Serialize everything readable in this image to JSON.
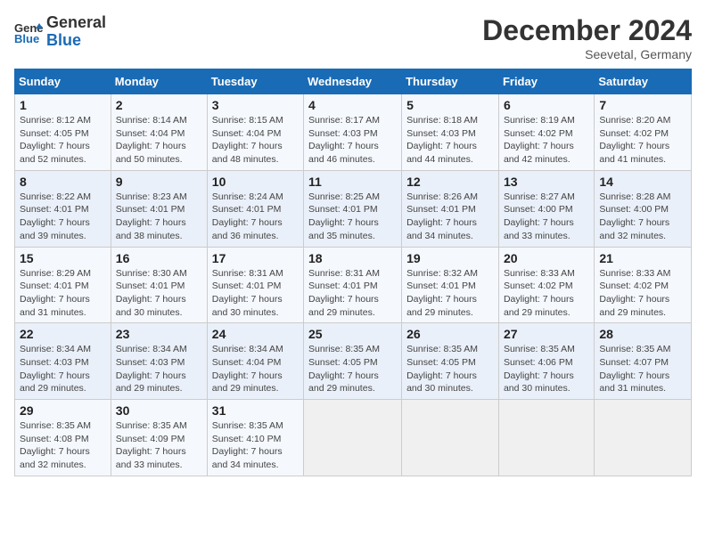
{
  "logo": {
    "line1": "General",
    "line2": "Blue"
  },
  "title": "December 2024",
  "subtitle": "Seevetal, Germany",
  "days_of_week": [
    "Sunday",
    "Monday",
    "Tuesday",
    "Wednesday",
    "Thursday",
    "Friday",
    "Saturday"
  ],
  "weeks": [
    [
      {
        "num": "1",
        "detail": "Sunrise: 8:12 AM\nSunset: 4:05 PM\nDaylight: 7 hours\nand 52 minutes."
      },
      {
        "num": "2",
        "detail": "Sunrise: 8:14 AM\nSunset: 4:04 PM\nDaylight: 7 hours\nand 50 minutes."
      },
      {
        "num": "3",
        "detail": "Sunrise: 8:15 AM\nSunset: 4:04 PM\nDaylight: 7 hours\nand 48 minutes."
      },
      {
        "num": "4",
        "detail": "Sunrise: 8:17 AM\nSunset: 4:03 PM\nDaylight: 7 hours\nand 46 minutes."
      },
      {
        "num": "5",
        "detail": "Sunrise: 8:18 AM\nSunset: 4:03 PM\nDaylight: 7 hours\nand 44 minutes."
      },
      {
        "num": "6",
        "detail": "Sunrise: 8:19 AM\nSunset: 4:02 PM\nDaylight: 7 hours\nand 42 minutes."
      },
      {
        "num": "7",
        "detail": "Sunrise: 8:20 AM\nSunset: 4:02 PM\nDaylight: 7 hours\nand 41 minutes."
      }
    ],
    [
      {
        "num": "8",
        "detail": "Sunrise: 8:22 AM\nSunset: 4:01 PM\nDaylight: 7 hours\nand 39 minutes."
      },
      {
        "num": "9",
        "detail": "Sunrise: 8:23 AM\nSunset: 4:01 PM\nDaylight: 7 hours\nand 38 minutes."
      },
      {
        "num": "10",
        "detail": "Sunrise: 8:24 AM\nSunset: 4:01 PM\nDaylight: 7 hours\nand 36 minutes."
      },
      {
        "num": "11",
        "detail": "Sunrise: 8:25 AM\nSunset: 4:01 PM\nDaylight: 7 hours\nand 35 minutes."
      },
      {
        "num": "12",
        "detail": "Sunrise: 8:26 AM\nSunset: 4:01 PM\nDaylight: 7 hours\nand 34 minutes."
      },
      {
        "num": "13",
        "detail": "Sunrise: 8:27 AM\nSunset: 4:00 PM\nDaylight: 7 hours\nand 33 minutes."
      },
      {
        "num": "14",
        "detail": "Sunrise: 8:28 AM\nSunset: 4:00 PM\nDaylight: 7 hours\nand 32 minutes."
      }
    ],
    [
      {
        "num": "15",
        "detail": "Sunrise: 8:29 AM\nSunset: 4:01 PM\nDaylight: 7 hours\nand 31 minutes."
      },
      {
        "num": "16",
        "detail": "Sunrise: 8:30 AM\nSunset: 4:01 PM\nDaylight: 7 hours\nand 30 minutes."
      },
      {
        "num": "17",
        "detail": "Sunrise: 8:31 AM\nSunset: 4:01 PM\nDaylight: 7 hours\nand 30 minutes."
      },
      {
        "num": "18",
        "detail": "Sunrise: 8:31 AM\nSunset: 4:01 PM\nDaylight: 7 hours\nand 29 minutes."
      },
      {
        "num": "19",
        "detail": "Sunrise: 8:32 AM\nSunset: 4:01 PM\nDaylight: 7 hours\nand 29 minutes."
      },
      {
        "num": "20",
        "detail": "Sunrise: 8:33 AM\nSunset: 4:02 PM\nDaylight: 7 hours\nand 29 minutes."
      },
      {
        "num": "21",
        "detail": "Sunrise: 8:33 AM\nSunset: 4:02 PM\nDaylight: 7 hours\nand 29 minutes."
      }
    ],
    [
      {
        "num": "22",
        "detail": "Sunrise: 8:34 AM\nSunset: 4:03 PM\nDaylight: 7 hours\nand 29 minutes."
      },
      {
        "num": "23",
        "detail": "Sunrise: 8:34 AM\nSunset: 4:03 PM\nDaylight: 7 hours\nand 29 minutes."
      },
      {
        "num": "24",
        "detail": "Sunrise: 8:34 AM\nSunset: 4:04 PM\nDaylight: 7 hours\nand 29 minutes."
      },
      {
        "num": "25",
        "detail": "Sunrise: 8:35 AM\nSunset: 4:05 PM\nDaylight: 7 hours\nand 29 minutes."
      },
      {
        "num": "26",
        "detail": "Sunrise: 8:35 AM\nSunset: 4:05 PM\nDaylight: 7 hours\nand 30 minutes."
      },
      {
        "num": "27",
        "detail": "Sunrise: 8:35 AM\nSunset: 4:06 PM\nDaylight: 7 hours\nand 30 minutes."
      },
      {
        "num": "28",
        "detail": "Sunrise: 8:35 AM\nSunset: 4:07 PM\nDaylight: 7 hours\nand 31 minutes."
      }
    ],
    [
      {
        "num": "29",
        "detail": "Sunrise: 8:35 AM\nSunset: 4:08 PM\nDaylight: 7 hours\nand 32 minutes."
      },
      {
        "num": "30",
        "detail": "Sunrise: 8:35 AM\nSunset: 4:09 PM\nDaylight: 7 hours\nand 33 minutes."
      },
      {
        "num": "31",
        "detail": "Sunrise: 8:35 AM\nSunset: 4:10 PM\nDaylight: 7 hours\nand 34 minutes."
      },
      null,
      null,
      null,
      null
    ]
  ]
}
